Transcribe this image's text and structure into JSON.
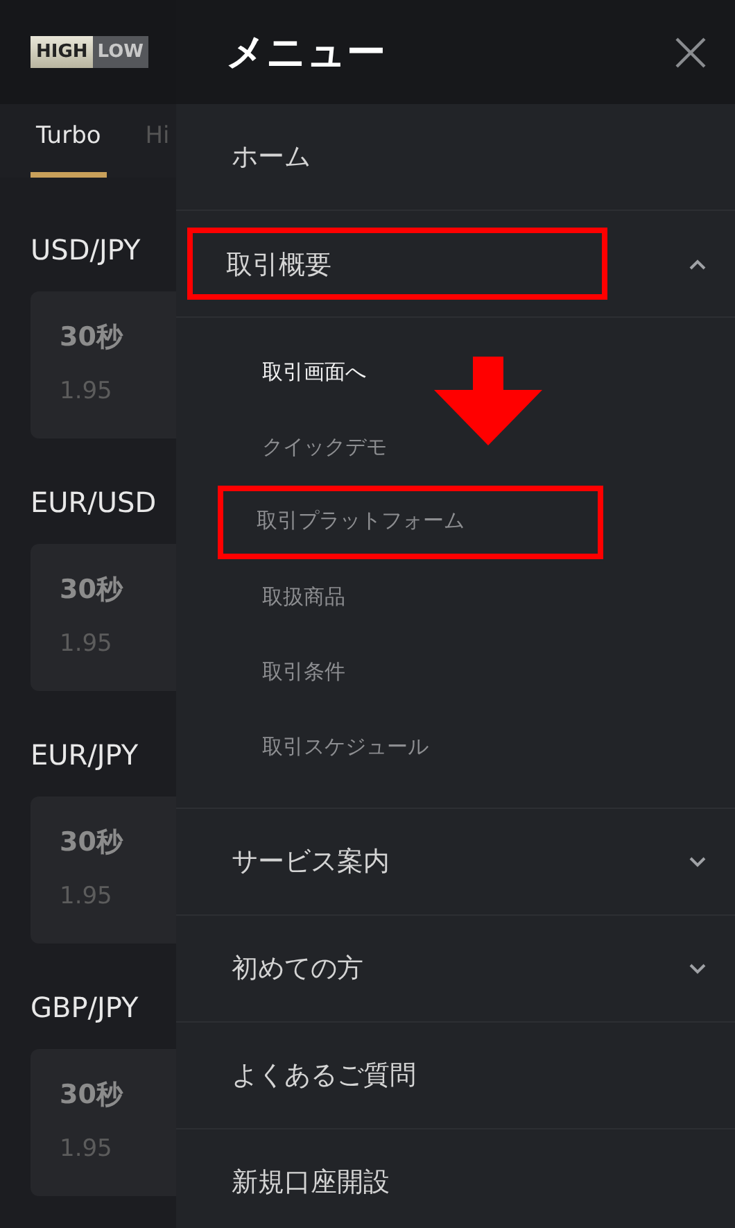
{
  "app": {
    "logo": {
      "left": "HIGH",
      "right": "LOW"
    },
    "tabs": [
      {
        "label": "Turbo",
        "selected": true
      },
      {
        "label": "Hi",
        "selected": false
      }
    ],
    "pairs": [
      {
        "name": "USD/JPY",
        "duration": "30秒",
        "payout": "1.95"
      },
      {
        "name": "EUR/USD",
        "duration": "30秒",
        "payout": "1.95"
      },
      {
        "name": "EUR/JPY",
        "duration": "30秒",
        "payout": "1.95"
      },
      {
        "name": "GBP/JPY",
        "duration": "30秒",
        "payout": "1.95"
      }
    ]
  },
  "menu": {
    "title": "メニュー",
    "items": [
      {
        "label": "ホーム",
        "kind": "link",
        "highlighted": false
      },
      {
        "label": "取引概要",
        "kind": "section",
        "expanded": true,
        "highlighted": true,
        "children": [
          {
            "label": "取引画面へ",
            "selected": true,
            "highlighted": false
          },
          {
            "label": "クイックデモ",
            "selected": false,
            "highlighted": false
          },
          {
            "label": "取引プラットフォーム",
            "selected": false,
            "highlighted": true
          },
          {
            "label": "取扱商品",
            "selected": false,
            "highlighted": false
          },
          {
            "label": "取引条件",
            "selected": false,
            "highlighted": false
          },
          {
            "label": "取引スケジュール",
            "selected": false,
            "highlighted": false
          }
        ]
      },
      {
        "label": "サービス案内",
        "kind": "section",
        "expanded": false,
        "highlighted": false
      },
      {
        "label": "初めての方",
        "kind": "section",
        "expanded": false,
        "highlighted": false
      },
      {
        "label": "よくあるご質問",
        "kind": "link",
        "highlighted": false
      },
      {
        "label": "新規口座開設",
        "kind": "link",
        "highlighted": false
      }
    ]
  },
  "annotation_arrow": true
}
